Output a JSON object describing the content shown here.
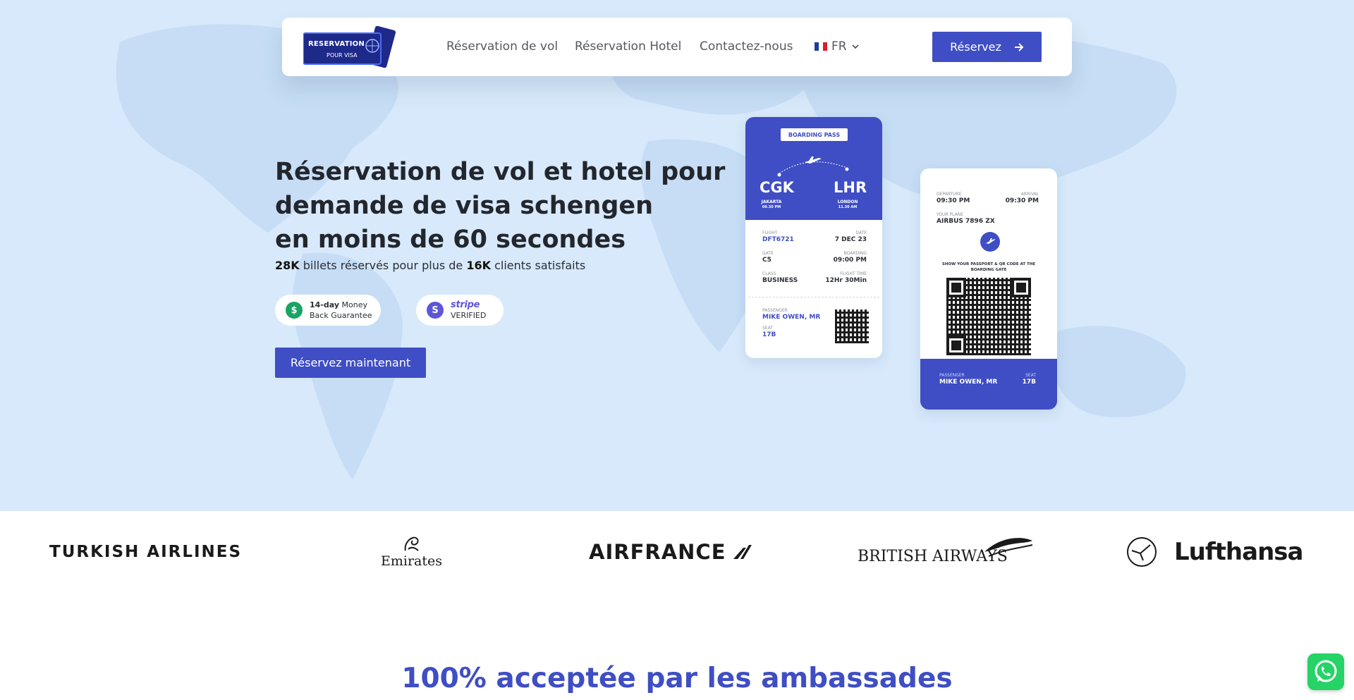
{
  "nav": {
    "logo_line1": "RESERVATION",
    "logo_line2": "POUR VISA",
    "links": [
      "Réservation de vol",
      "Réservation Hotel",
      "Contactez-nous"
    ],
    "language": "FR",
    "cta_label": "Réservez"
  },
  "hero": {
    "headline": [
      "Réservation de vol et hotel pour",
      "demande de visa schengen",
      "en moins de 60 secondes"
    ],
    "sub_tickets": "28K",
    "sub_mid": " billets réservés pour plus de ",
    "sub_clients": "16K",
    "sub_end": " clients satisfaits",
    "badge_guarantee": {
      "bold": "14-day",
      "rest": " Money",
      "line2": "Back Guarantee"
    },
    "badge_stripe": {
      "brand": "stripe",
      "label": "VERIFIED"
    },
    "cta_label": "Réservez maintenant"
  },
  "ticket1": {
    "label": "BOARDING PASS",
    "from_code": "CGK",
    "from_city": "JAKARTA",
    "from_time": "09.30 PM",
    "to_code": "LHR",
    "to_city": "LONDON",
    "to_time": "11.30 AM",
    "flight_label": "FLIGHT",
    "flight": "DFT6721",
    "date_label": "DATE",
    "date": "7 DEC 23",
    "gate_label": "GATE",
    "gate": "C5",
    "boarding_label": "BOARDING",
    "boarding": "09:00 PM",
    "class_label": "CLASS",
    "class": "BUSINESS",
    "flighttime_label": "FLIGHT TIME",
    "flighttime": "12Hr 30Min",
    "passenger_label": "PASSENGER",
    "passenger": "MIKE OWEN, MR",
    "seat_label": "SEAT",
    "seat": "17B"
  },
  "ticket2": {
    "departure_label": "DEPARTURE",
    "departure": "09:30 PM",
    "arrival_label": "ARRIVAL",
    "arrival": "09:30 PM",
    "plane_label": "YOUR PLANE",
    "plane": "AIRBUS 7896 ZX",
    "instruction": "SHOW YOUR PASSPORT & QR CODE AT THE BOARDING GATE",
    "passenger_label": "PASSENGER",
    "passenger": "MIKE OWEN, MR",
    "seat_label": "SEAT",
    "seat": "17B"
  },
  "airlines": [
    "TURKISH AIRLINES",
    "Emirates",
    "AIRFRANCE",
    "BRITISH AIRWAYS",
    "Lufthansa"
  ],
  "section_title": "100% acceptée par les ambassades",
  "colors": {
    "primary": "#3f4ec4",
    "hero_bg": "#d7e9fa",
    "whatsapp": "#25d366"
  },
  "icons": {
    "whatsapp": "whatsapp-icon",
    "arrow": "arrow-right-icon"
  }
}
